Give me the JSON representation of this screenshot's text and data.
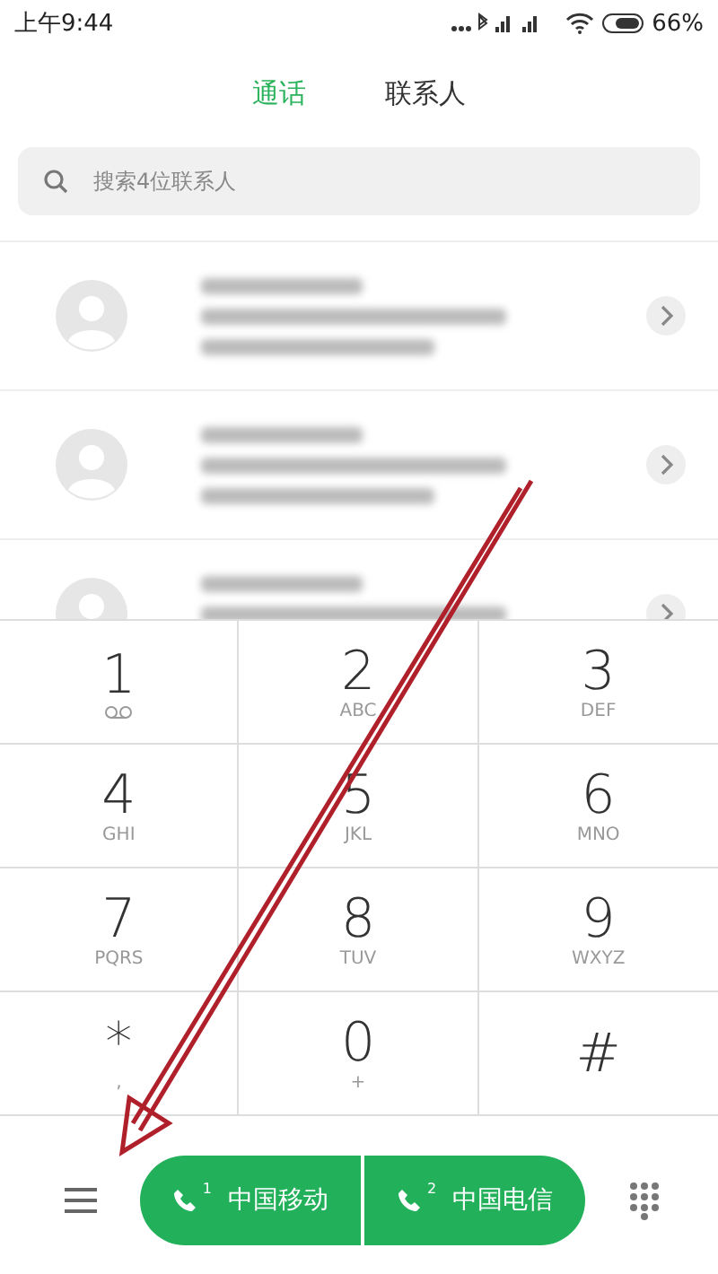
{
  "status_bar": {
    "time": "上午9:44",
    "battery": "66%"
  },
  "tabs": [
    {
      "label": "通话",
      "selected": true
    },
    {
      "label": "联系人",
      "selected": false
    }
  ],
  "search": {
    "placeholder": "搜索4位联系人"
  },
  "contacts": [
    {
      "kind": "blurred"
    },
    {
      "kind": "blurred"
    },
    {
      "kind": "blurred"
    }
  ],
  "keypad": [
    {
      "digit": "1",
      "kind": "voicemail"
    },
    {
      "digit": "2",
      "letters": "ABC"
    },
    {
      "digit": "3",
      "letters": "DEF"
    },
    {
      "digit": "4",
      "letters": "GHI"
    },
    {
      "digit": "5",
      "letters": "JKL"
    },
    {
      "digit": "6",
      "letters": "MNO"
    },
    {
      "digit": "7",
      "letters": "PQRS"
    },
    {
      "digit": "8",
      "letters": "TUV"
    },
    {
      "digit": "9",
      "letters": "WXYZ"
    },
    {
      "digit": "*",
      "letters": ","
    },
    {
      "digit": "0",
      "letters": "+"
    },
    {
      "digit": "#"
    }
  ],
  "call_buttons": [
    {
      "sim": "1",
      "label": "中国移动"
    },
    {
      "sim": "2",
      "label": "中国电信"
    }
  ]
}
